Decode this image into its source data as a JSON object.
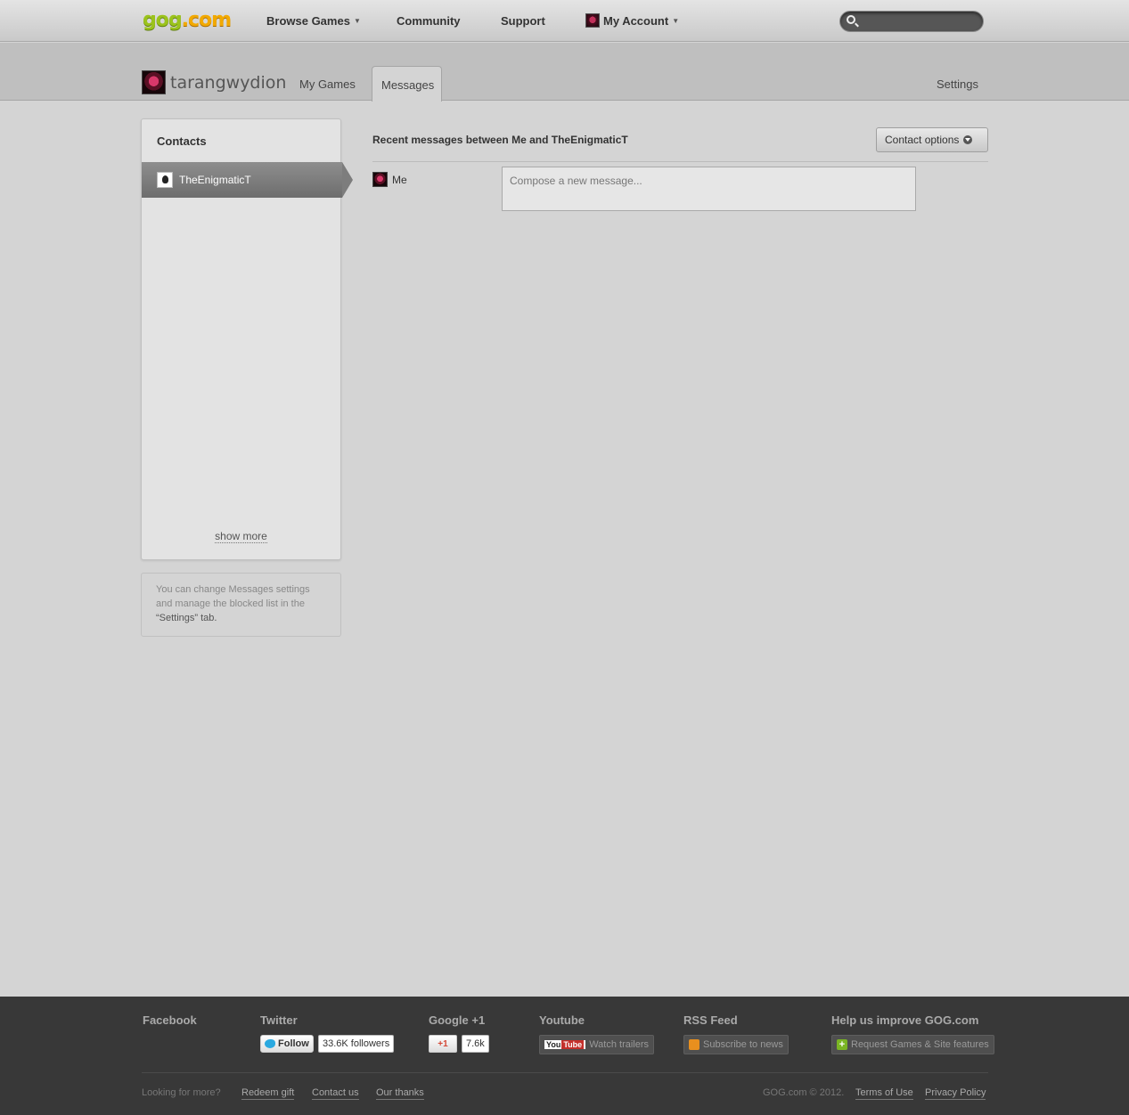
{
  "nav": {
    "logo_part1": "gog",
    "logo_part2": ".com",
    "browse_games": "Browse Games",
    "community": "Community",
    "support": "Support",
    "my_account": "My Account",
    "search_placeholder": ""
  },
  "user": {
    "name": "tarangwydion",
    "tabs": [
      "My Games",
      "Messages"
    ],
    "settings": "Settings"
  },
  "contacts": {
    "title": "Contacts",
    "items": [
      {
        "name": "TheEnigmaticT"
      }
    ],
    "show_more": "show more",
    "hint_pre": "You can change Messages settings and manage the blocked list in the ",
    "hint_tab": "“Settings” tab."
  },
  "messages": {
    "title": "Recent messages between Me and TheEnigmaticT",
    "contact_options": "Contact options",
    "me_label": "Me",
    "compose_placeholder": "Compose a new message..."
  },
  "footer": {
    "facebook": "Facebook",
    "twitter": "Twitter",
    "twitter_follow": "Follow",
    "twitter_followers": "33.6K followers",
    "google": "Google +1",
    "google_btn": "+1",
    "google_count": "7.6k",
    "youtube": "Youtube",
    "youtube_logo_you": "You",
    "youtube_logo_tube": "Tube",
    "youtube_btn": "Watch trailers",
    "rss": "RSS Feed",
    "rss_btn": "Subscribe to news",
    "improve": "Help us improve GOG.com",
    "improve_btn": "Request Games & Site features",
    "looking": "Looking for more?",
    "redeem": "Redeem gift",
    "contact_us": "Contact us",
    "our_thanks": "Our thanks",
    "copyright": "GOG.com © 2012.",
    "terms": "Terms of Use",
    "privacy": "Privacy Policy"
  }
}
